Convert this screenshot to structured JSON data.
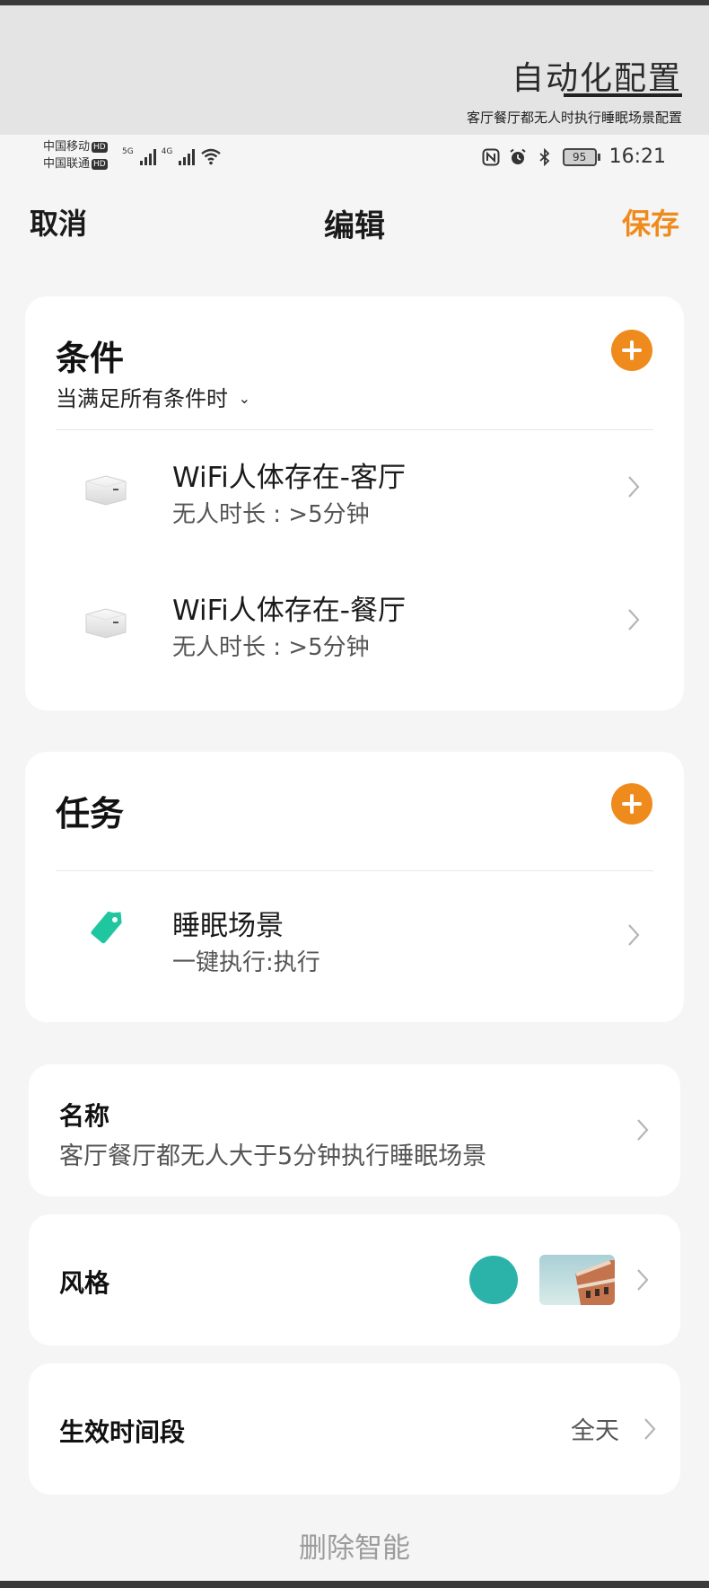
{
  "banner": {
    "title": "自动化配置",
    "subtitle": "客厅餐厅都无人时执行睡眠场景配置"
  },
  "status_bar": {
    "carrier1": "中国移动",
    "carrier2": "中国联通",
    "hd": "HD",
    "signal1_tag": "5G",
    "signal2_tag": "4G",
    "battery": "95",
    "time": "16:21",
    "icons": [
      "nfc-icon",
      "alarm-icon",
      "bluetooth-icon",
      "wifi-icon",
      "battery-icon"
    ]
  },
  "nav": {
    "cancel": "取消",
    "title": "编辑",
    "save": "保存",
    "accent_color": "#ef8b1d"
  },
  "conditions": {
    "title": "条件",
    "mode": "当满足所有条件时",
    "items": [
      {
        "title": "WiFi人体存在-客厅",
        "subtitle": "无人时长 : >5分钟",
        "icon": "presence-sensor-icon"
      },
      {
        "title": "WiFi人体存在-餐厅",
        "subtitle": "无人时长 : >5分钟",
        "icon": "presence-sensor-icon"
      }
    ]
  },
  "tasks": {
    "title": "任务",
    "items": [
      {
        "title": "睡眠场景",
        "subtitle": "一键执行:执行",
        "icon": "scene-tag-icon",
        "icon_color": "#1fc7a0"
      }
    ]
  },
  "name_field": {
    "label": "名称",
    "value": "客厅餐厅都无人大于5分钟执行睡眠场景"
  },
  "style_field": {
    "label": "风格",
    "color": "#2bb3aa"
  },
  "time_field": {
    "label": "生效时间段",
    "value": "全天"
  },
  "delete_label": "删除智能"
}
